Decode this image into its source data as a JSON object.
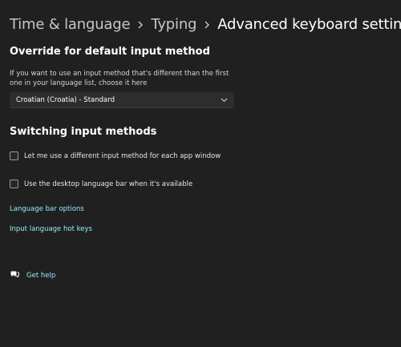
{
  "breadcrumb": {
    "items": [
      "Time & language",
      "Typing"
    ],
    "current": "Advanced keyboard settings"
  },
  "override": {
    "title": "Override for default input method",
    "description": "If you want to use an input method that's different than the first one in your language list, choose it here",
    "dropdown_value": "Croatian (Croatia) - Standard"
  },
  "switching": {
    "title": "Switching input methods",
    "options": [
      {
        "label": "Let me use a different input method for each app window",
        "checked": false
      },
      {
        "label": "Use the desktop language bar when it's available",
        "checked": false
      }
    ]
  },
  "links": {
    "language_bar_options": "Language bar options",
    "input_language_hot_keys": "Input language hot keys"
  },
  "help": {
    "label": "Get help"
  },
  "icons": {
    "breadcrumb_separator": "chevron-right-icon",
    "dropdown": "chevron-down-icon",
    "help": "help-chat-icon"
  },
  "colors": {
    "background": "#202020",
    "link": "#99ebff",
    "control": "#2d2d2d"
  }
}
